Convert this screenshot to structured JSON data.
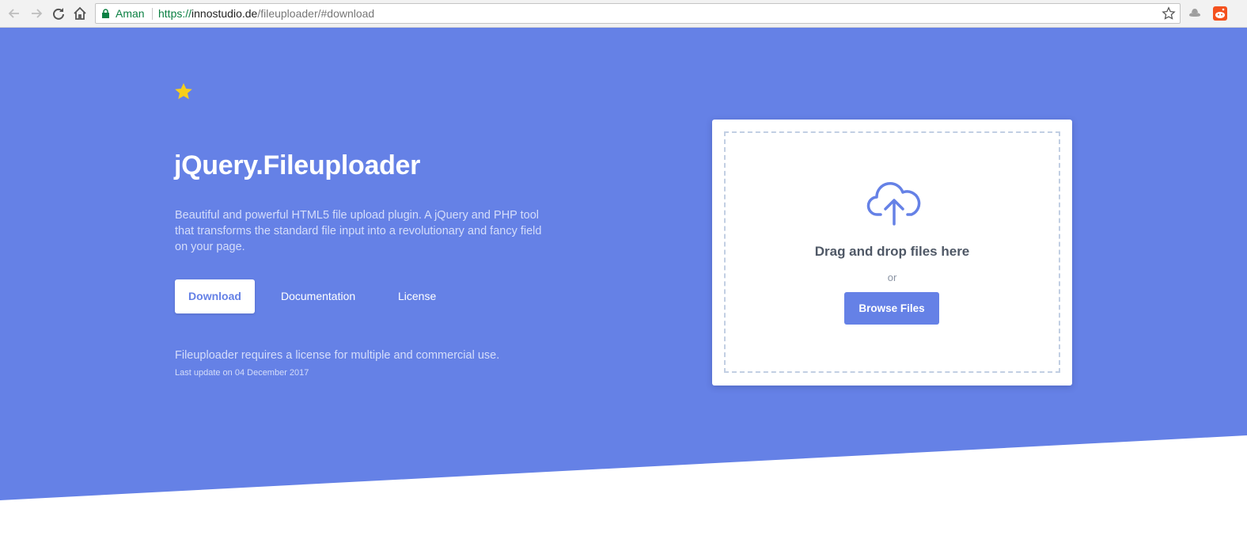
{
  "browser": {
    "secure_label": "Aman",
    "url_scheme": "https://",
    "url_host": "innostudio.de",
    "url_path": "/fileuploader/#download",
    "icons": [
      "back-arrow-icon",
      "forward-arrow-icon",
      "reload-icon",
      "home-icon",
      "lock-icon",
      "bookmark-star-icon",
      "extension-incognito-icon",
      "extension-reddit-icon"
    ]
  },
  "hero": {
    "title": "jQuery.Fileuploader",
    "description": "Beautiful and powerful HTML5 file upload plugin. A jQuery and PHP tool that transforms the standard file input into a revolutionary and fancy field on your page.",
    "buttons": {
      "download": "Download",
      "documentation": "Documentation",
      "license": "License"
    },
    "license_note": "Fileuploader requires a license for multiple and commercial use.",
    "last_update": "Last update on 04 December 2017",
    "logo_icon": "star-icon"
  },
  "uploader": {
    "title": "Drag and drop files here",
    "or": "or",
    "browse_button": "Browse Files",
    "icon": "cloud-upload-icon"
  },
  "colors": {
    "brand": "#6581e6",
    "star": "#f7cf1b",
    "secure_green": "#0b8043"
  }
}
